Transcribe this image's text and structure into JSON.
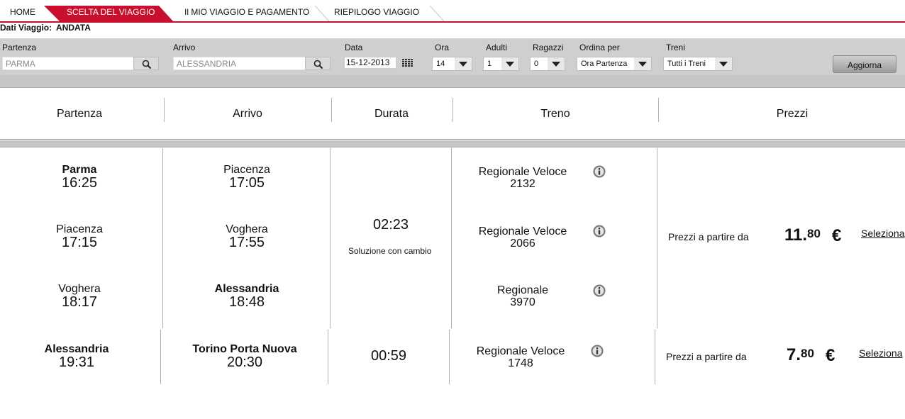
{
  "steps": {
    "home": "HOME",
    "active": "SCELTA DEL VIAGGIO",
    "step2": "Il MIO VIAGGIO E PAGAMENTO",
    "step3": "RIEPILOGO VIAGGIO",
    "accent_color": "#c8102e"
  },
  "dati": {
    "label": "Dati Viaggio:",
    "value": "ANDATA"
  },
  "search": {
    "partenza_label": "Partenza",
    "partenza_value": "PARMA",
    "arrivo_label": "Arrivo",
    "arrivo_value": "ALESSANDRIA",
    "data_label": "Data",
    "data_value": "15-12-2013",
    "ora_label": "Ora",
    "ora_value": "14",
    "adulti_label": "Adulti",
    "adulti_value": "1",
    "ragazzi_label": "Ragazzi",
    "ragazzi_value": "0",
    "ordina_label": "Ordina per",
    "ordina_value": "Ora Partenza",
    "treni_label": "Treni",
    "treni_value": "Tutti i Treni",
    "aggiorna_label": "Aggiorna"
  },
  "table": {
    "headers": [
      "Partenza",
      "Arrivo",
      "Durata",
      "Treno",
      "Prezzi"
    ]
  },
  "solutions": [
    {
      "legs": [
        {
          "dep_place": "Parma",
          "dep_time": "16:25",
          "arr_place": "Piacenza",
          "arr_time": "17:05",
          "train_name": "Regionale Veloce",
          "train_num": "2132"
        },
        {
          "dep_place": "Piacenza",
          "dep_time": "17:15",
          "arr_place": "Voghera",
          "arr_time": "17:55",
          "train_name": "Regionale Veloce",
          "train_num": "2066"
        },
        {
          "dep_place": "Voghera",
          "dep_time": "18:17",
          "arr_place": "Alessandria",
          "arr_time": "18:48",
          "train_name": "Regionale",
          "train_num": "3970"
        }
      ],
      "duration": "02:23",
      "note": "Soluzione con cambio",
      "price_label": "Prezzi a partire da",
      "price_int": "11.",
      "price_dec": "80",
      "currency": "€",
      "select_label": "Seleziona"
    },
    {
      "legs": [
        {
          "dep_place": "Alessandria",
          "dep_time": "19:31",
          "arr_place": "Torino Porta Nuova",
          "arr_time": "20:30",
          "train_name": "Regionale Veloce",
          "train_num": "1748"
        }
      ],
      "duration": "00:59",
      "price_label": "Prezzi a partire da",
      "price_int": "7.",
      "price_dec": "80",
      "currency": "€",
      "select_label": "Seleziona"
    }
  ],
  "icons": {
    "search": "magnifier-icon",
    "calendar": "calendar-icon",
    "info": "info-icon"
  }
}
